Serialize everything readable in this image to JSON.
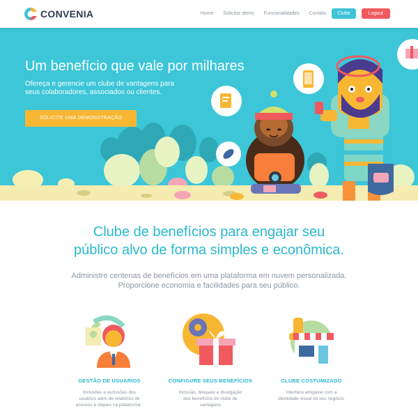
{
  "header": {
    "logo_text": "CONVENIA",
    "nav": [
      "Home",
      "Solicitar demo",
      "Funcionalidades",
      "Contato"
    ],
    "clube_label": "Clube",
    "logout_label": "Logout"
  },
  "hero": {
    "title": "Um benefício que vale por milhares",
    "subtitle": "Ofereça e gerencie um clube de vantagens para seus colaboradores, associados ou clientes.",
    "cta_label": "SOLICITE UMA DEMONSTRAÇÃO"
  },
  "section": {
    "title_line1": "Clube de benefícios para engajar seu",
    "title_line2": "público alvo de forma simples e econômica.",
    "desc_line1": "Administre centenas de benefícios em uma plataforma em nuvem personalizada.",
    "desc_line2": "Proporcione economia e facilidades para seu público."
  },
  "features": [
    {
      "icon": "users-management-icon",
      "title": "GESTÃO DE USUÁRIOS",
      "desc_lines": [
        "Inclusões e exclusões dos",
        "usuários além de relatórios de",
        "acessos e cliques na plataforma ."
      ]
    },
    {
      "icon": "gift-settings-icon",
      "title": "CONFIGURE SEUS BENEFÍCIOS",
      "desc_lines": [
        "Inclusão, bloqueio e divulgação",
        "dos benefícios do clube de",
        "vantagens"
      ]
    },
    {
      "icon": "storefront-icon",
      "title": "CLUBE COSTUMIZADO",
      "desc_lines": [
        "Interface amigável com a",
        "identidade visual do seu negócio."
      ]
    }
  ],
  "colors": {
    "brand_text": "#2e3b4e",
    "accent": "#3ec3d6",
    "hero_bg": "#3cc6d8",
    "cta": "#f7b733",
    "logout": "#f05a5f"
  }
}
